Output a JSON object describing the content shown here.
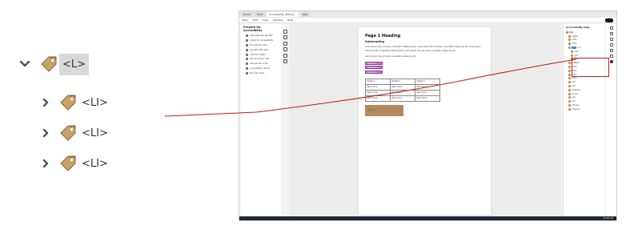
{
  "zoomed_tree": {
    "parent": {
      "label": "<L>",
      "chevron": "chevron-down-icon",
      "icon": "tag-icon"
    },
    "children": [
      {
        "label": "<LI>",
        "chevron": "chevron-right-icon",
        "icon": "tag-icon"
      },
      {
        "label": "<LI>",
        "chevron": "chevron-right-icon",
        "icon": "tag-icon"
      },
      {
        "label": "<LI>",
        "chevron": "chevron-right-icon",
        "icon": "tag-icon"
      }
    ]
  },
  "annotation": {
    "line_color": "#c21b1b",
    "highlight_color": "#c21b1b"
  },
  "app": {
    "tabs": [
      "Home",
      "Tools",
      "Accessibility_Testing...",
      "New"
    ],
    "menu": [
      "Menu",
      "Edit",
      "View",
      "Window",
      "Help"
    ],
    "left_panel": {
      "title": "Prepare for accessibility",
      "items": [
        "Automatically tag PDF",
        "Check for accessibility",
        "Fix reading order",
        "Set alternate text",
        "Add form fields",
        "Set document title",
        "Change tab order",
        "Accessibility report",
        "Run full check"
      ]
    },
    "document": {
      "heading1": "Page 1 Heading",
      "heading2": "Subheading",
      "paragraph1": "Lorem ipsum dolor sit amet, consectetur adipiscing elit. Lorem ipsum dolor sit amet, consectetur adipiscing elit. Lorem ipsum dolor sit amet, consectetur adipiscing elit. Lorem ipsum dolor sit amet, consectetur adipiscing elit.",
      "paragraph2": "Lorem ipsum dolor sit amet, consectetur adipiscing elit.",
      "list_items": [
        "List item 1",
        "List item 2",
        "List item 3"
      ],
      "table": {
        "headers": [
          "Header 1",
          "Header 2",
          "Header 3"
        ],
        "rows": [
          [
            "Row 1 Col 1",
            "Row 1 Col 2",
            "Row 1 Col 3"
          ],
          [
            "Row 2 Col 1",
            "Row 2 Col 2",
            "Row 2 Col 3"
          ],
          [
            "Row 3 Col 1",
            "Row 3 Col 2",
            "Row 3 Col 3"
          ]
        ]
      },
      "button_label": "Click me"
    },
    "right_panel": {
      "title": "Accessibility tags",
      "rows": [
        "Tags",
        "<Part>",
        "<H1>",
        "<H2>",
        "<L>",
        "<LI>",
        "<LI>",
        "<LI>",
        "<Table>",
        "<TR>",
        "<TR>",
        "<TR>",
        "<TR>",
        "<P>",
        "<P>",
        "<Figure>",
        "<Link>",
        "<P>",
        "<P>",
        "<Form>",
        "<Figure>"
      ]
    },
    "taskbar_time": "10:24 AM"
  }
}
